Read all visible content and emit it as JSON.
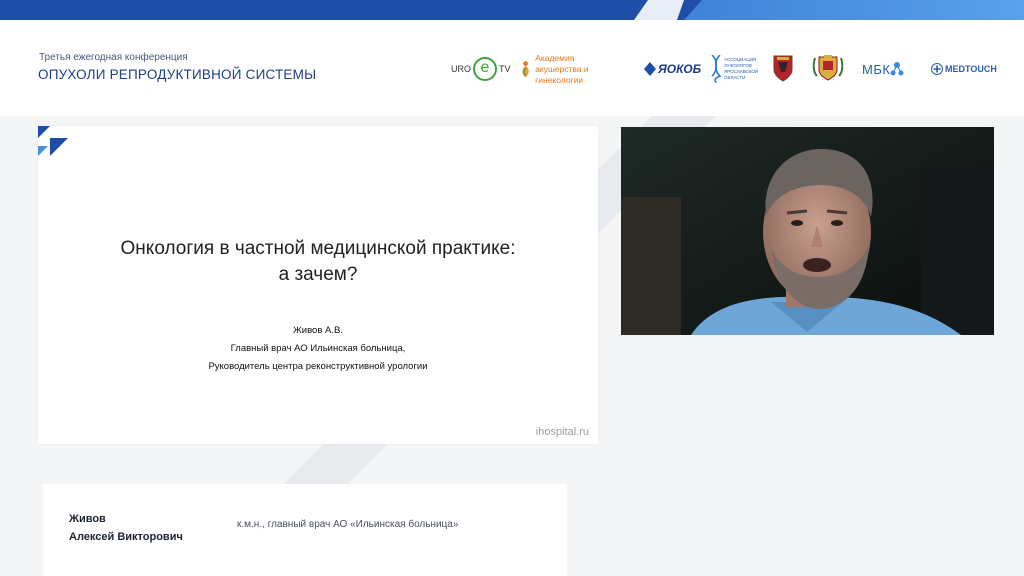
{
  "conference": {
    "subtitle": "Третья ежегодная конференция",
    "title": "ОПУХОЛИ РЕПРОДУКТИВНОЙ СИСТЕМЫ"
  },
  "partners": {
    "uro_tv": {
      "left": "URO",
      "mid": "e",
      "right": "TV"
    },
    "academy": {
      "line1": "Академия акушерства и",
      "line2": "гинекологии"
    },
    "yakob": "ЯОКОБ",
    "association": {
      "line1": "АССОЦИАЦИЯ",
      "line2": "ОНКОЛОГОВ",
      "line3": "ЯРОСЛАВСКОЙ",
      "line4": "ОБЛАСТИ"
    },
    "mbk": "МБК",
    "medtouch": "MEDTOUCH"
  },
  "slide": {
    "title_line1": "Онкология в частной медицинской практике:",
    "title_line2": "а зачем?",
    "author": "Живов А.В.",
    "role1": "Главный врач АО Ильинская больница,",
    "role2": "Руководитель центра реконструктивной урологии",
    "url": "ihospital.ru"
  },
  "speaker": {
    "surname": "Живов",
    "given": "Алексей Викторович",
    "role": "к.м.н., главный врач АО «Ильинская больница»"
  },
  "colors": {
    "brand_dark": "#1f4ea8",
    "brand_light": "#4a90e2",
    "title_blue": "#1c3f86",
    "green": "#3aa53a",
    "orange": "#e8771e",
    "shirt_blue": "#6fa6d8"
  }
}
